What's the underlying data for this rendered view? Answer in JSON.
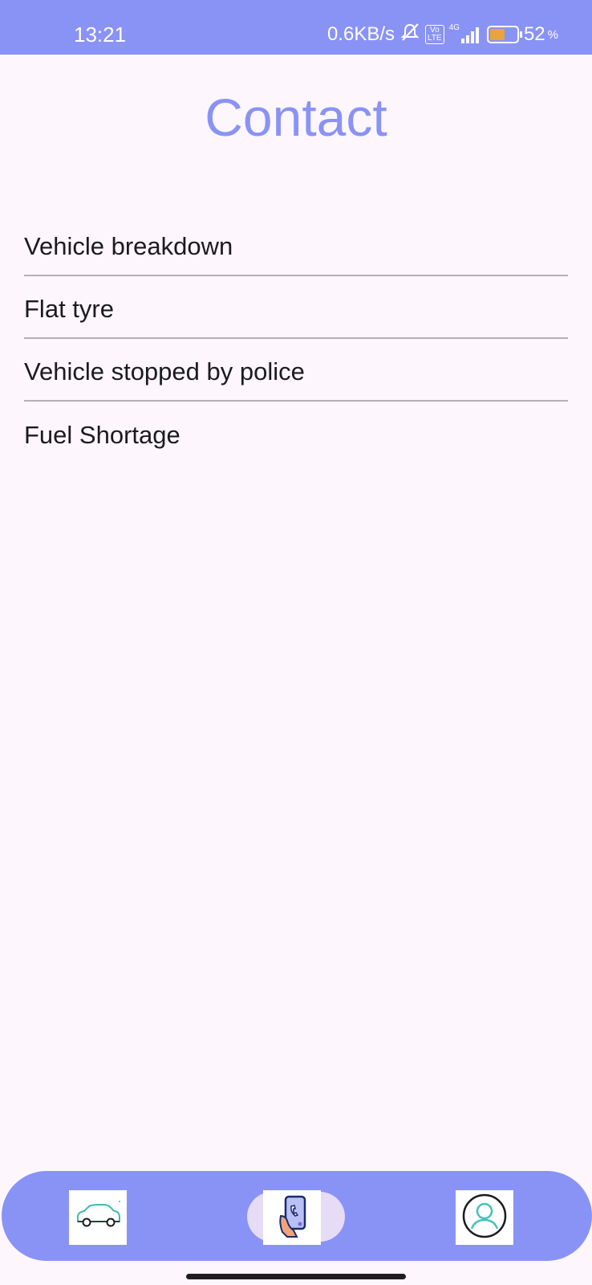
{
  "status_bar": {
    "time": "13:21",
    "network_speed": "0.6KB/s",
    "volte_label": "Vo\nLTE",
    "network_type": "4G",
    "battery_percent": "52",
    "battery_percent_sign": "%",
    "icons": [
      "mute-icon",
      "volte-icon",
      "signal-icon",
      "battery-icon"
    ]
  },
  "page": {
    "title": "Contact"
  },
  "issues": [
    {
      "label": "Vehicle breakdown"
    },
    {
      "label": "Flat tyre"
    },
    {
      "label": "Vehicle stopped by police"
    },
    {
      "label": "Fuel Shortage"
    }
  ],
  "bottom_nav": {
    "items": [
      {
        "icon": "car-icon",
        "active": false
      },
      {
        "icon": "phone-contact-icon",
        "active": true
      },
      {
        "icon": "profile-icon",
        "active": false
      }
    ],
    "colors": {
      "bar": "#8993f6",
      "active_pill": "#e6dcf6"
    }
  },
  "colors": {
    "accent": "#8993f6",
    "background": "#fdf6fd",
    "divider": "#b4b0b6"
  }
}
